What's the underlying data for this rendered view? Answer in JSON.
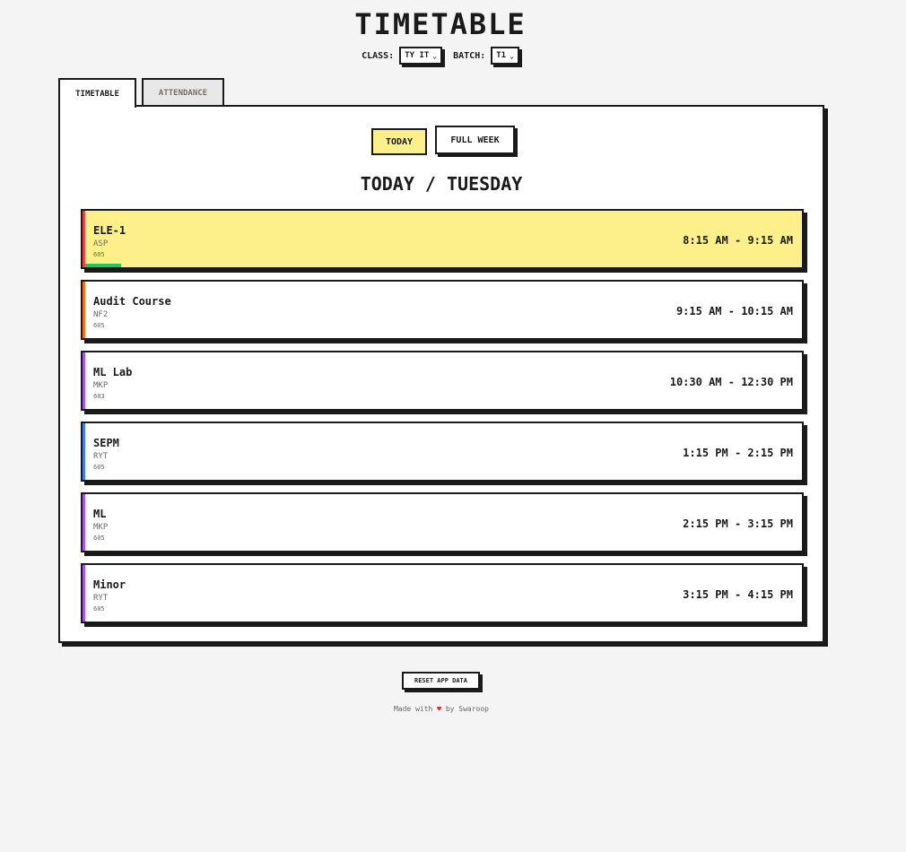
{
  "app": {
    "title": "TIMETABLE"
  },
  "selectors": {
    "class_label": "CLASS:",
    "class_value": "TY IT",
    "batch_label": "BATCH:",
    "batch_value": "T1"
  },
  "tabs": [
    {
      "label": "TIMETABLE",
      "active": true
    },
    {
      "label": "ATTENDANCE",
      "active": false
    }
  ],
  "view_toggle": {
    "today": "TODAY",
    "full_week": "FULL WEEK",
    "selected": "TODAY"
  },
  "day_heading": "TODAY / TUESDAY",
  "classes": [
    {
      "subject": "ELE-1",
      "teacher": "ASP",
      "room": "605",
      "time": "8:15 AM - 9:15 AM",
      "accent": "#ef4444",
      "current": true,
      "progress": 0.05
    },
    {
      "subject": "Audit Course",
      "teacher": "NF2",
      "room": "605",
      "time": "9:15 AM - 10:15 AM",
      "accent": "#f97316",
      "current": false
    },
    {
      "subject": "ML Lab",
      "teacher": "MKP",
      "room": "603",
      "time": "10:30 AM - 12:30 PM",
      "accent": "#a855f7",
      "current": false
    },
    {
      "subject": "SEPM",
      "teacher": "RYT",
      "room": "605",
      "time": "1:15 PM - 2:15 PM",
      "accent": "#3b82f6",
      "current": false
    },
    {
      "subject": "ML",
      "teacher": "MKP",
      "room": "605",
      "time": "2:15 PM - 3:15 PM",
      "accent": "#a855f7",
      "current": false
    },
    {
      "subject": "Minor",
      "teacher": "RYT",
      "room": "605",
      "time": "3:15 PM - 4:15 PM",
      "accent": "#a855f7",
      "current": false
    }
  ],
  "footer": {
    "reset_label": "RESET APP DATA",
    "made_with": "Made with",
    "heart": "♥",
    "by": "by Swaroop"
  },
  "colors": {
    "highlight": "#fdef8a",
    "progress": "#22c55e",
    "border": "#1a1a1a"
  }
}
